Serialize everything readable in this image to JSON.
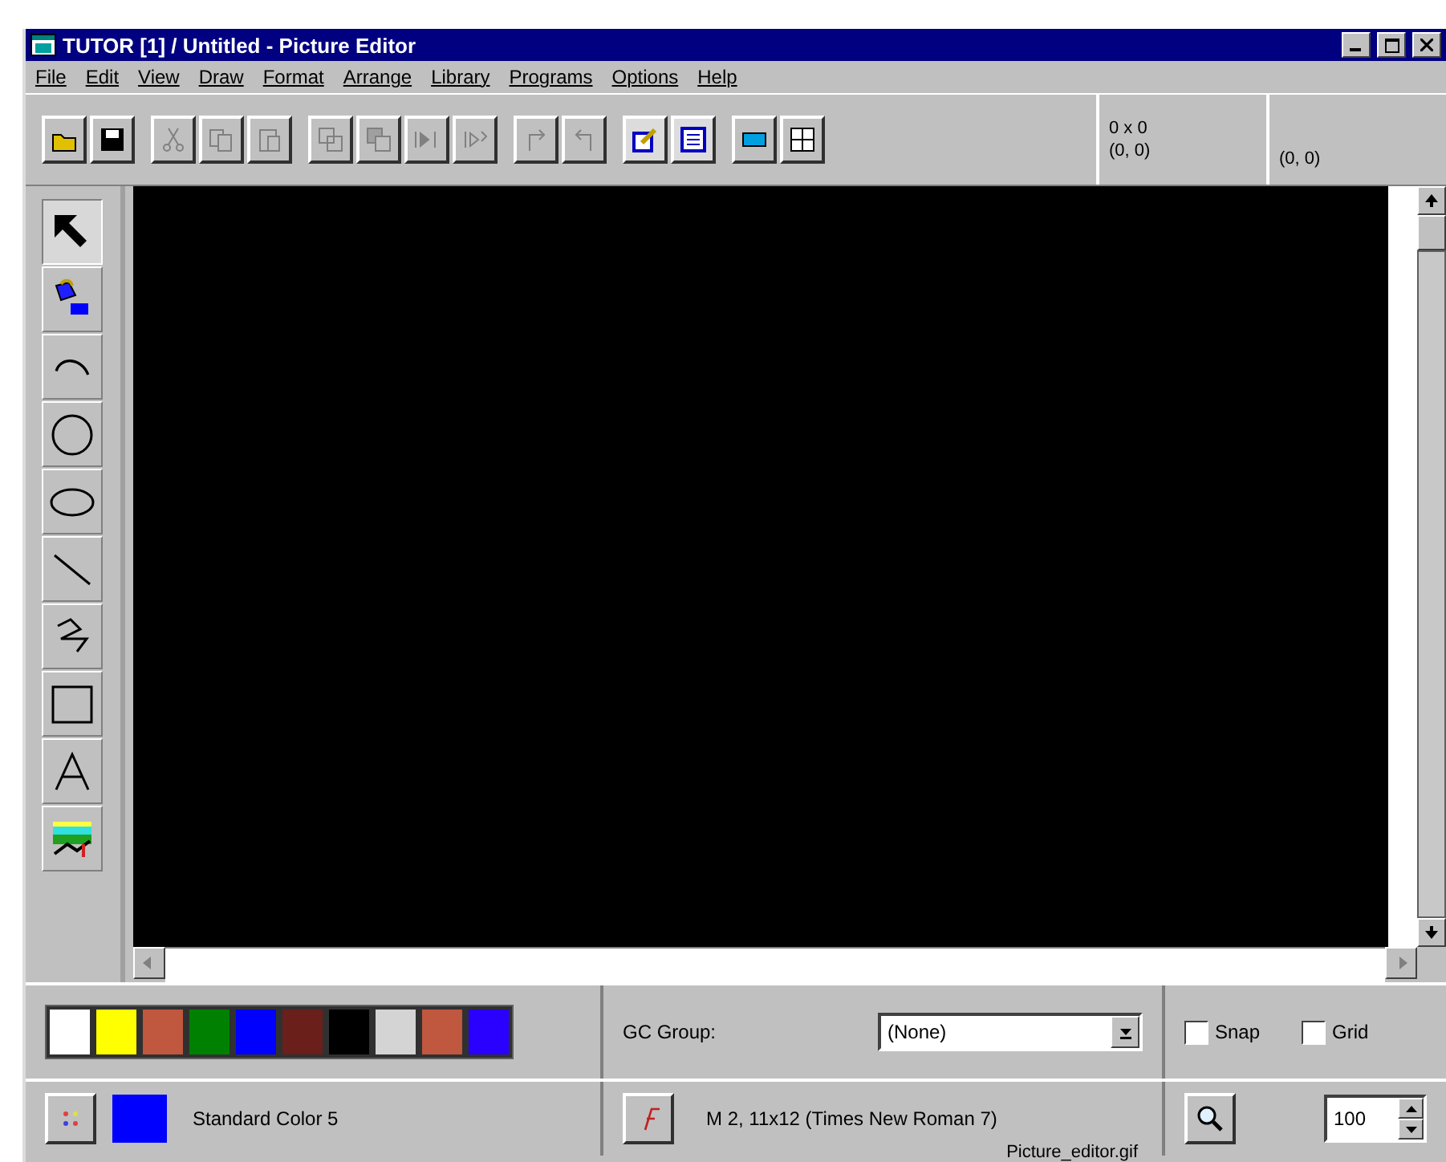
{
  "window": {
    "title": "TUTOR [1] / Untitled - Picture Editor"
  },
  "menu": [
    "File",
    "Edit",
    "View",
    "Draw",
    "Format",
    "Arrange",
    "Library",
    "Programs",
    "Options",
    "Help"
  ],
  "toolbar": [
    [
      {
        "kind": "open"
      },
      {
        "kind": "save"
      }
    ],
    [
      {
        "kind": "cut"
      },
      {
        "kind": "copy"
      },
      {
        "kind": "paste"
      }
    ],
    [
      {
        "kind": "front"
      },
      {
        "kind": "back"
      },
      {
        "kind": "align-left"
      },
      {
        "kind": "align-right"
      }
    ],
    [
      {
        "kind": "redo"
      },
      {
        "kind": "undo"
      }
    ],
    [
      {
        "kind": "edit-points"
      },
      {
        "kind": "properties"
      }
    ],
    [
      {
        "kind": "layer"
      },
      {
        "kind": "grid"
      }
    ]
  ],
  "size": {
    "dimensions": "0 x 0",
    "origin": "(0, 0)"
  },
  "cursor": "(0, 0)",
  "tools": [
    {
      "kind": "pointer",
      "selected": true
    },
    {
      "kind": "fill",
      "selected": false
    },
    {
      "kind": "arc",
      "selected": false
    },
    {
      "kind": "circle",
      "selected": false
    },
    {
      "kind": "ellipse",
      "selected": false
    },
    {
      "kind": "line",
      "selected": false
    },
    {
      "kind": "polyline",
      "selected": false
    },
    {
      "kind": "rectangle",
      "selected": false
    },
    {
      "kind": "text",
      "selected": false
    },
    {
      "kind": "picture",
      "selected": false
    }
  ],
  "palette": [
    {
      "color": "#ffffff"
    },
    {
      "color": "#ffff00"
    },
    {
      "color": "#c0573f"
    },
    {
      "color": "#008000"
    },
    {
      "color": "#0000ff"
    },
    {
      "color": "#6b1f1a"
    },
    {
      "color": "#000000"
    },
    {
      "color": "#d4d4d4"
    },
    {
      "color": "#c0573f"
    },
    {
      "color": "#2a00ff"
    }
  ],
  "gc_group": {
    "label": "GC Group:",
    "value": "(None)"
  },
  "options": [
    {
      "label": "Snap",
      "checked": false
    },
    {
      "label": "Grid",
      "checked": false
    }
  ],
  "current_color": {
    "color": "#0000ff",
    "name": "Standard Color 5"
  },
  "font_info": "M 2, 11x12  (Times New Roman 7)",
  "zoom": "100",
  "caption": "Picture_editor.gif"
}
